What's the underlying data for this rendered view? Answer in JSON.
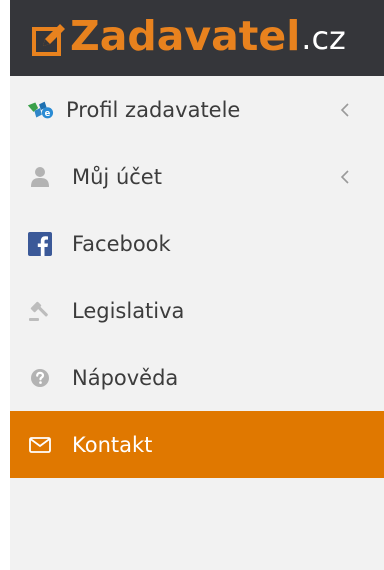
{
  "header": {
    "logo_name": "Zadavatel",
    "logo_tld": ".cz",
    "brand_color": "#e8821e",
    "header_background": "#35363a"
  },
  "menu": {
    "active_color": "#e07800",
    "items": [
      {
        "label": "Profil zadavatele",
        "icon": "profile-puzzle-icon",
        "has_submenu": true,
        "active": false
      },
      {
        "label": "Můj účet",
        "icon": "user-icon",
        "has_submenu": true,
        "active": false
      },
      {
        "label": "Facebook",
        "icon": "facebook-icon",
        "has_submenu": false,
        "active": false
      },
      {
        "label": "Legislativa",
        "icon": "gavel-icon",
        "has_submenu": false,
        "active": false
      },
      {
        "label": "Nápověda",
        "icon": "help-icon",
        "has_submenu": false,
        "active": false
      },
      {
        "label": "Kontakt",
        "icon": "envelope-icon",
        "has_submenu": false,
        "active": true
      }
    ]
  }
}
